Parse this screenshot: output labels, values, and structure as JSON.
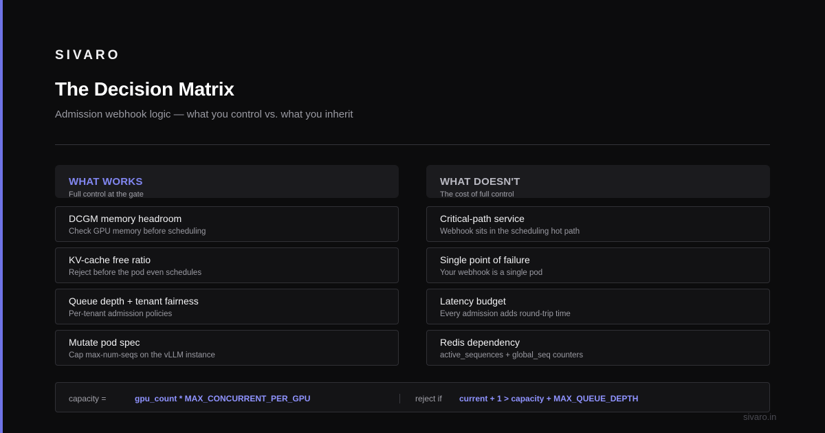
{
  "brand": "SIVARO",
  "title": "The Decision Matrix",
  "subtitle": "Admission webhook logic — what you control vs. what you inherit",
  "colors": {
    "accent": "#6f74e6",
    "works_heading": "#8186f0",
    "doesnt_heading": "#b9b9c2",
    "formula_expr": "#8f93ff"
  },
  "works": {
    "heading": "WHAT WORKS",
    "subheading": "Full control at the gate",
    "items": [
      {
        "title": "DCGM memory headroom",
        "desc": "Check GPU memory before scheduling"
      },
      {
        "title": "KV-cache free ratio",
        "desc": "Reject before the pod even schedules"
      },
      {
        "title": "Queue depth + tenant fairness",
        "desc": "Per-tenant admission policies"
      },
      {
        "title": "Mutate pod spec",
        "desc": "Cap max-num-seqs on the vLLM instance"
      }
    ]
  },
  "doesnt": {
    "heading": "WHAT DOESN'T",
    "subheading": "The cost of full control",
    "items": [
      {
        "title": "Critical-path service",
        "desc": "Webhook sits in the scheduling hot path"
      },
      {
        "title": "Single point of failure",
        "desc": "Your webhook is a single pod"
      },
      {
        "title": "Latency budget",
        "desc": "Every admission adds round-trip time"
      },
      {
        "title": "Redis dependency",
        "desc": "active_sequences + global_seq counters"
      }
    ]
  },
  "formula": {
    "capacity_label": "capacity =",
    "capacity_expr": "gpu_count * MAX_CONCURRENT_PER_GPU",
    "reject_label": "reject if",
    "reject_expr": "current + 1 > capacity + MAX_QUEUE_DEPTH"
  },
  "footer": "sivaro.in"
}
